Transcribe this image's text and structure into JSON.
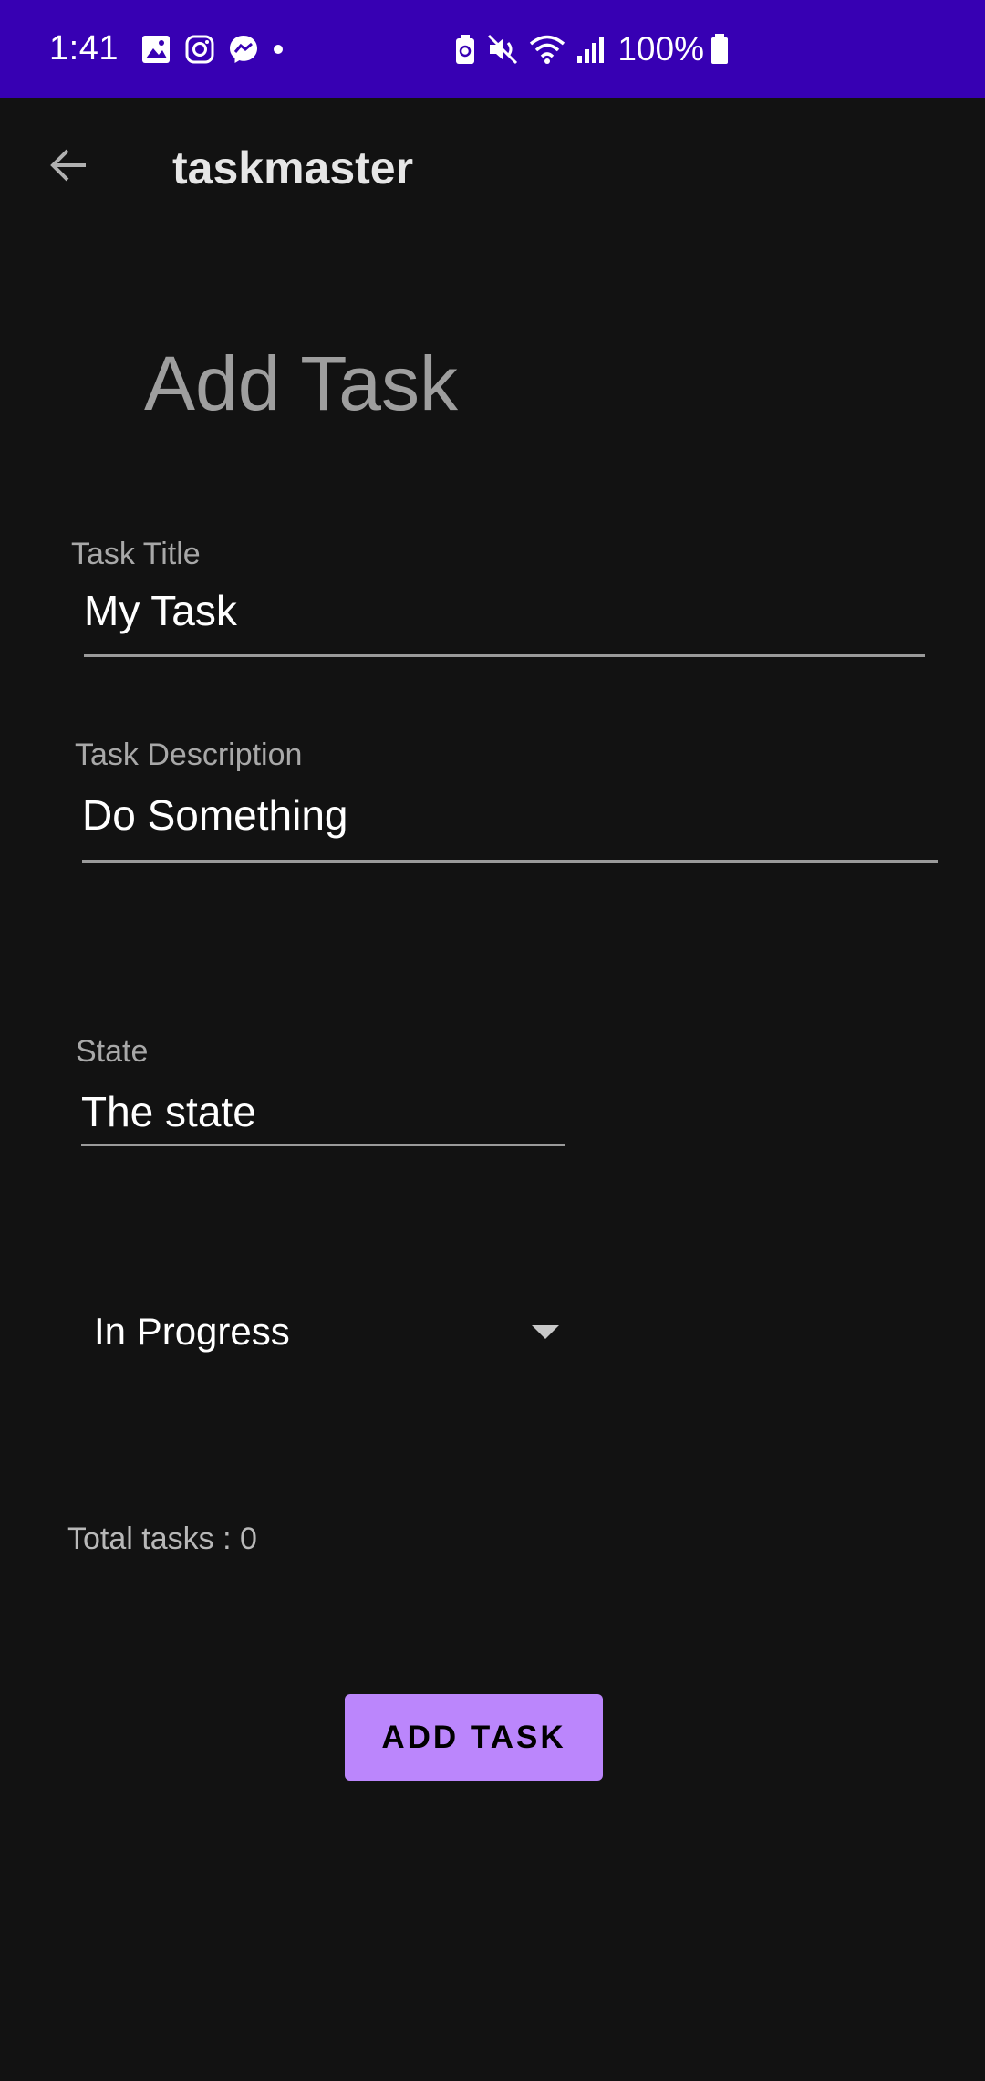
{
  "status_bar": {
    "time": "1:41",
    "battery_text": "100%",
    "left_icons": [
      "gallery-icon",
      "instagram-icon",
      "messenger-icon",
      "dot-icon"
    ],
    "right_icons": [
      "battery-saver-icon",
      "mute-icon",
      "wifi-icon",
      "signal-icon",
      "battery-icon"
    ],
    "background_color": "#3700b3"
  },
  "app_bar": {
    "back_icon": "arrow-left-icon",
    "title": "taskmaster"
  },
  "form": {
    "heading": "Add Task",
    "task_title": {
      "label": "Task Title",
      "value": "My Task"
    },
    "task_description": {
      "label": "Task Description",
      "value": "Do Something"
    },
    "state": {
      "label": "State",
      "value": "The state"
    },
    "status_select": {
      "selected": "In Progress"
    }
  },
  "total_tasks": "Total tasks : 0",
  "add_button": {
    "label": "ADD TASK",
    "color": "#bb86fc"
  }
}
